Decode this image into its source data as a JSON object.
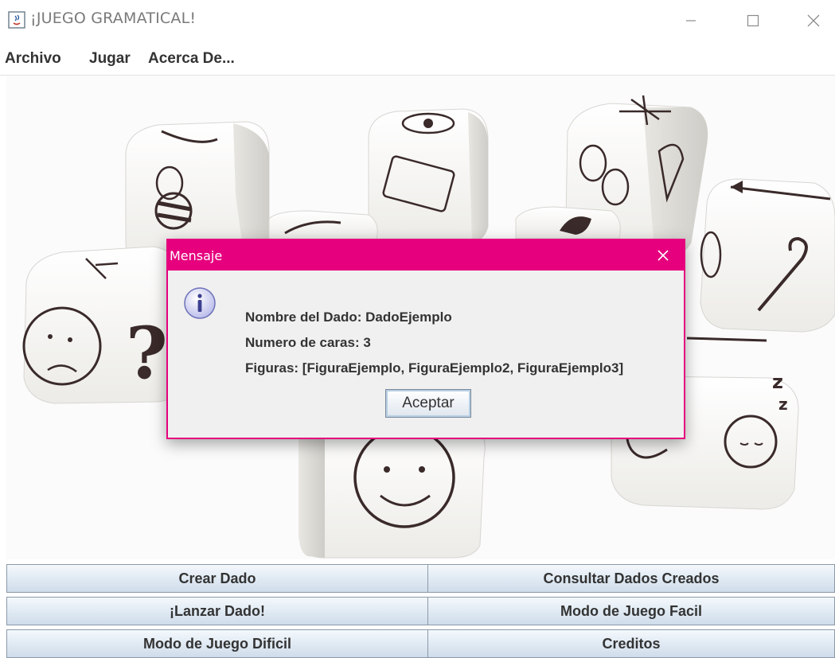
{
  "window": {
    "title": "¡JUEGO GRAMATICAL!"
  },
  "menu": {
    "items": [
      "Archivo",
      "Jugar",
      "Acerca De..."
    ]
  },
  "dialog": {
    "title": "Mensaje",
    "lines": [
      "Nombre del Dado: DadoEjemplo",
      "Numero de caras: 3",
      "Figuras: [FiguraEjemplo, FiguraEjemplo2, FiguraEjemplo3]"
    ],
    "ok_label": "Aceptar",
    "icon": "info-icon"
  },
  "buttons": [
    [
      "Crear Dado",
      "Consultar Dados Creados"
    ],
    [
      "¡Lanzar Dado!",
      "Modo de Juego Facil"
    ],
    [
      "Modo de Juego Dificil",
      "Creditos"
    ]
  ],
  "colors": {
    "dialog_accent": "#e6007e",
    "button_gradient_top": "#f4f8fc",
    "button_gradient_bottom": "#cfdcea"
  }
}
